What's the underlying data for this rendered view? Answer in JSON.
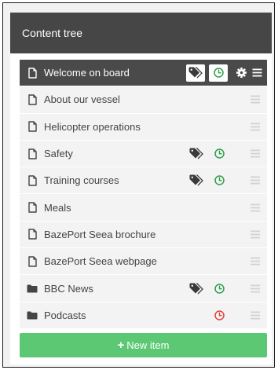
{
  "header": {
    "title": "Content tree"
  },
  "colors": {
    "header_bg": "#464646",
    "selected_row_bg": "#4a4a4a",
    "row_bg": "#f3f3f3",
    "clock_active": "#2e9e48",
    "clock_expired": "#e0413a",
    "new_item_bg": "#5cc873"
  },
  "tree": {
    "items": [
      {
        "label": "Welcome on board",
        "icon": "page-icon",
        "selected": true,
        "tag": true,
        "clock": "green"
      },
      {
        "label": "About our vessel",
        "icon": "page-icon",
        "selected": false,
        "tag": false,
        "clock": null
      },
      {
        "label": "Helicopter operations",
        "icon": "page-icon",
        "selected": false,
        "tag": false,
        "clock": null
      },
      {
        "label": "Safety",
        "icon": "page-icon",
        "selected": false,
        "tag": true,
        "clock": "green"
      },
      {
        "label": "Training courses",
        "icon": "page-icon",
        "selected": false,
        "tag": true,
        "clock": "green"
      },
      {
        "label": "Meals",
        "icon": "page-icon",
        "selected": false,
        "tag": false,
        "clock": null
      },
      {
        "label": "BazePort Seea brochure",
        "icon": "page-icon",
        "selected": false,
        "tag": false,
        "clock": null
      },
      {
        "label": "BazePort Seea webpage",
        "icon": "page-icon",
        "selected": false,
        "tag": false,
        "clock": null
      },
      {
        "label": "BBC News",
        "icon": "folder-icon",
        "selected": false,
        "tag": true,
        "clock": "green"
      },
      {
        "label": "Podcasts",
        "icon": "folder-icon",
        "selected": false,
        "tag": false,
        "clock": "red"
      }
    ]
  },
  "footer": {
    "new_item_label": "New item",
    "new_item_icon": "plus-icon"
  }
}
